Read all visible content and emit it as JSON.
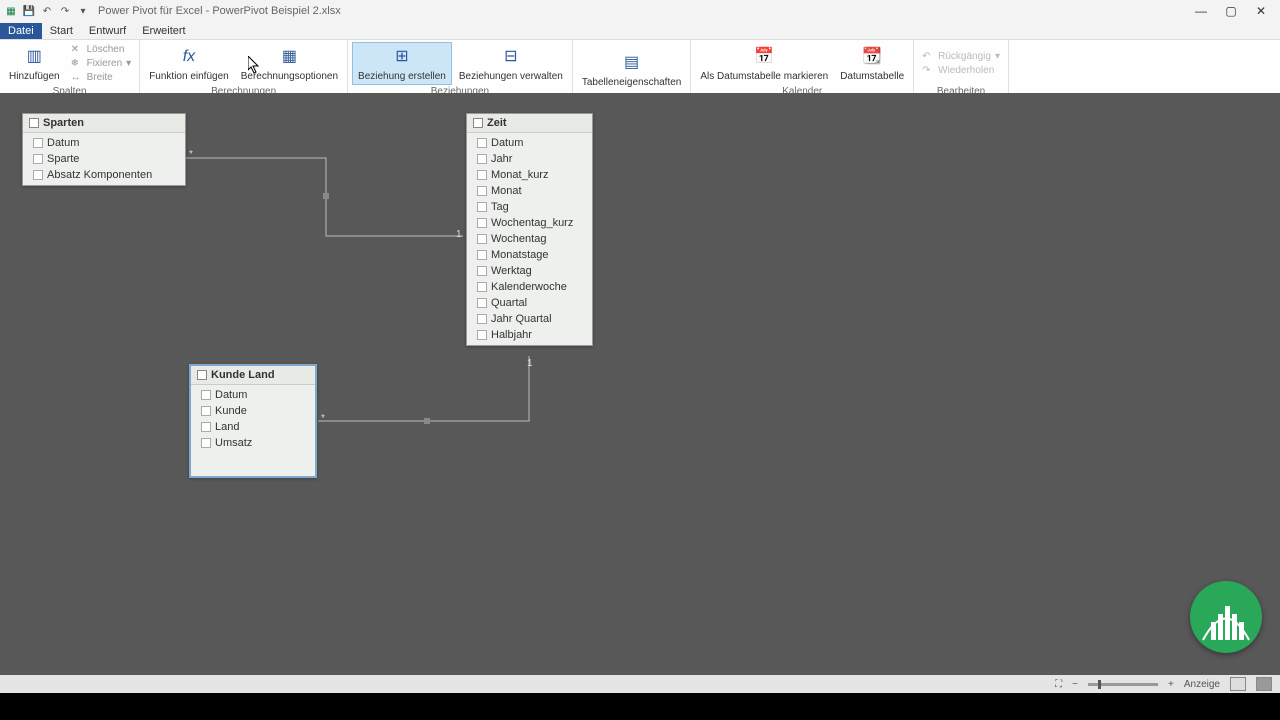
{
  "title": "Power Pivot für Excel - PowerPivot Beispiel 2.xlsx",
  "tabs": {
    "datei": "Datei",
    "start": "Start",
    "entwurf": "Entwurf",
    "erweitert": "Erweitert"
  },
  "ribbon": {
    "spalten": {
      "label": "Spalten",
      "hinzufuegen": "Hinzufügen",
      "loeschen": "Löschen",
      "fixieren": "Fixieren",
      "breite": "Breite"
    },
    "berechnungen": {
      "label": "Berechnungen",
      "funktion": "Funktion einfügen",
      "optionen": "Berechnungsoptionen"
    },
    "beziehungen": {
      "label": "Beziehungen",
      "erstellen": "Beziehung erstellen",
      "verwalten": "Beziehungen verwalten"
    },
    "tabellen": {
      "label": "",
      "eigenschaften": "Tabelleneigenschaften"
    },
    "kalender": {
      "label": "Kalender",
      "markieren": "Als Datumstabelle markieren",
      "tabelle": "Datumstabelle"
    },
    "bearbeiten": {
      "label": "Bearbeiten",
      "rueckgaengig": "Rückgängig",
      "wiederholen": "Wiederholen"
    }
  },
  "tables": {
    "sparten": {
      "title": "Sparten",
      "fields": [
        "Datum",
        "Sparte",
        "Absatz Komponenten"
      ]
    },
    "zeit": {
      "title": "Zeit",
      "fields": [
        "Datum",
        "Jahr",
        "Monat_kurz",
        "Monat",
        "Tag",
        "Wochentag_kurz",
        "Wochentag",
        "Monatstage",
        "Werktag",
        "Kalenderwoche",
        "Quartal",
        "Jahr Quartal",
        "Halbjahr"
      ]
    },
    "kunde": {
      "title": "Kunde Land",
      "fields": [
        "Datum",
        "Kunde",
        "Land",
        "Umsatz"
      ]
    }
  },
  "statusbar": {
    "anzeige": "Anzeige"
  }
}
